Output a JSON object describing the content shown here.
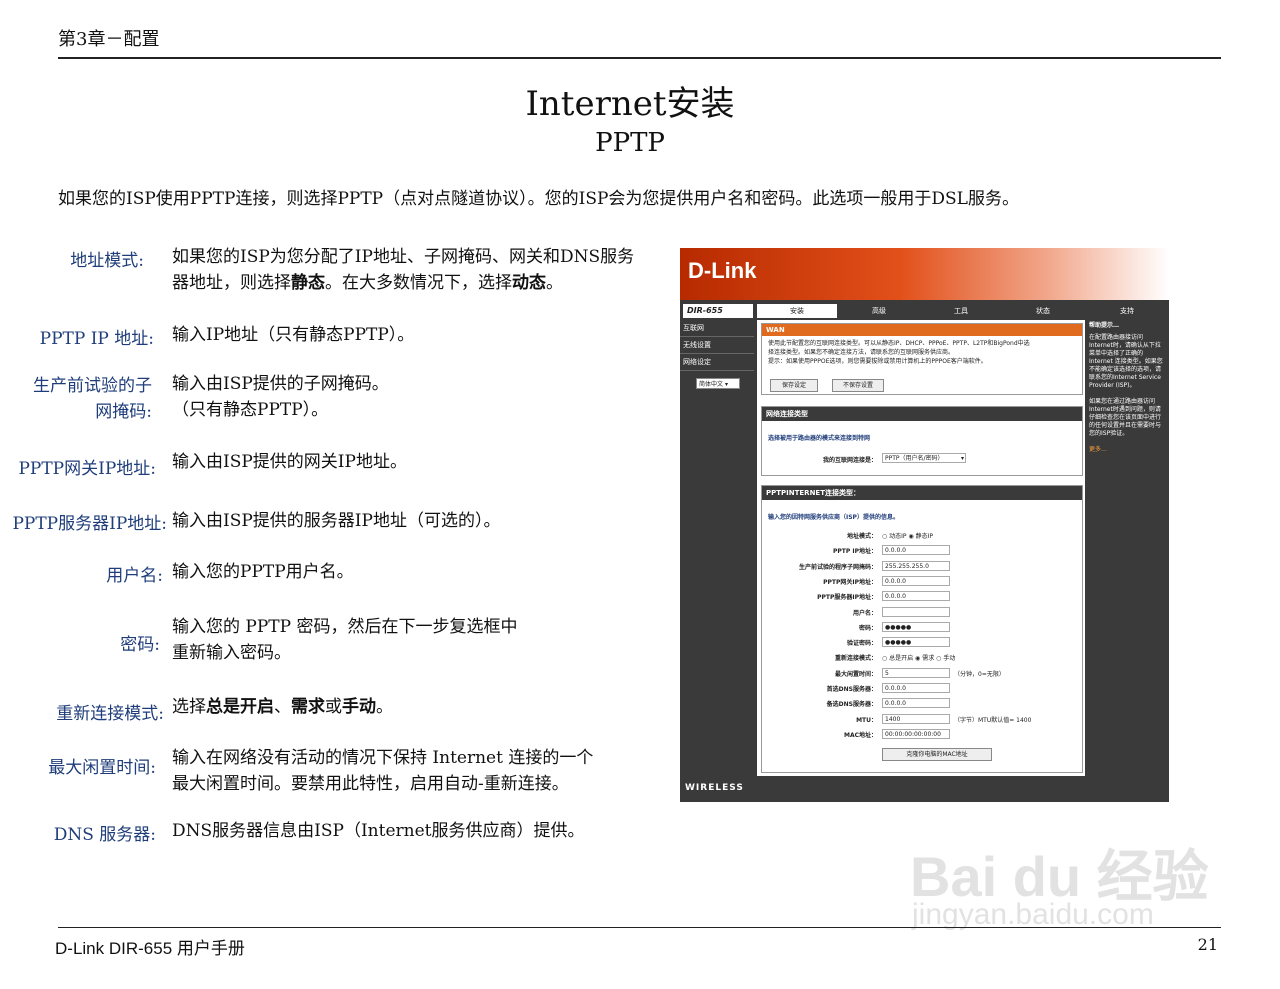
{
  "header": {
    "chapter": "第3章－配置"
  },
  "title": "Internet安装",
  "subtitle": "PPTP",
  "intro": "如果您的ISP使用PPTP连接，则选择PPTP（点对点隧道协议）。您的ISP会为您提供用户名和密码。此选项一般用于DSL服务。",
  "fields": {
    "address_mode": {
      "label": "地址模式:",
      "line1": "如果您的ISP为您分配了IP地址、子网掩码、网关和DNS服务",
      "line2a": "器地址，则选择",
      "line2b": "静态",
      "line2c": "。在大多数情况下，选择",
      "line2d": "动态",
      "line2e": "。"
    },
    "pptp_ip": {
      "label": "PPTP IP 地址:",
      "desc": "输入IP地址（只有静态PPTP）。"
    },
    "subnet": {
      "label1": "生产前试验的子",
      "label2": "网掩码:",
      "line1": "输入由ISP提供的子网掩码。",
      "line2": "（只有静态PPTP）。"
    },
    "gateway": {
      "label": "PPTP网关IP地址:",
      "desc": "输入由ISP提供的网关IP地址。"
    },
    "server": {
      "label": "PPTP服务器IP地址:",
      "desc": "输入由ISP提供的服务器IP地址（可选的）。"
    },
    "username": {
      "label": "用户名:",
      "desc": "输入您的PPTP用户名。"
    },
    "password": {
      "label": "密码:",
      "line1": "输入您的 PPTP 密码，然后在下一步复选框中",
      "line2": "重新输入密码。"
    },
    "reconnect": {
      "label": "重新连接模式:",
      "a": "选择",
      "b": "总是开启",
      "c": "、",
      "d": "需求",
      "e": "或",
      "f": "手动",
      "g": "。"
    },
    "idle": {
      "label": "最大闲置时间:",
      "line1": "输入在网络没有活动的情况下保持 Internet 连接的一个",
      "line2": "最大闲置时间。要禁用此特性，启用自动-重新连接。"
    },
    "dns": {
      "label": "DNS 服务器:",
      "desc": "DNS服务器信息由ISP（Internet服务供应商）提供。"
    }
  },
  "footer": {
    "left": "D-Link DIR-655 用户手册",
    "page": "21"
  },
  "router": {
    "logo": "D-Link",
    "model": "DIR-655",
    "tabs": [
      "安装",
      "高级",
      "工具",
      "状态",
      "支持"
    ],
    "side": [
      "互联网",
      "无线设置",
      "网络设定"
    ],
    "lang": "简体中文",
    "wan": {
      "title": "WAN",
      "text1": "使用此节配置您的互联网连接类型。可以从静态IP、DHCP、PPPoE、PPTP、L2TP和BigPond中选",
      "text2": "择连接类型。如果您不确定连接方法，请联系您的互联网服务供应商。",
      "text3": "提示：如果使用PPPOE选项，则您需要拔除或禁用计算机上的PPPOE客户端软件。",
      "save": "保存设定",
      "nosave": "不保存设置"
    },
    "conn": {
      "title": "网络连接类型",
      "desc": "选择被用于路由器的模式来连接到特网",
      "key": "我的互联网连接是：",
      "val": "PPTP（用户名/密码）"
    },
    "pptp": {
      "title": "PPTPINTERNET连接类型：",
      "desc": "输入您的因特网服务供应商（ISP）提供的信息。",
      "rows": [
        {
          "k": "地址模式：",
          "v": "",
          "t": "○ 动态IP ◉ 静态IP"
        },
        {
          "k": "PPTP IP地址：",
          "v": "0.0.0.0",
          "t": ""
        },
        {
          "k": "生产前试验的程序子网掩码：",
          "v": "255.255.255.0",
          "t": ""
        },
        {
          "k": "PPTP网关IP地址：",
          "v": "0.0.0.0",
          "t": ""
        },
        {
          "k": "PPTP服务器IP地址：",
          "v": "0.0.0.0",
          "t": ""
        },
        {
          "k": "用户名：",
          "v": "",
          "t": ""
        },
        {
          "k": "密码：",
          "v": "●●●●●",
          "t": ""
        },
        {
          "k": "验证密码：",
          "v": "●●●●●",
          "t": ""
        },
        {
          "k": "重新连接模式：",
          "v": "",
          "t": "○ 总是开启 ◉ 需求 ○ 手动"
        },
        {
          "k": "最大闲置时间：",
          "v": "5",
          "t": "（分钟，0=无限）"
        },
        {
          "k": "首选DNS服务器：",
          "v": "0.0.0.0",
          "t": ""
        },
        {
          "k": "备选DNS服务器：",
          "v": "0.0.0.0",
          "t": ""
        },
        {
          "k": "MTU：",
          "v": "1400",
          "t": "（字节）MTU默认值= 1400"
        },
        {
          "k": "MAC地址：",
          "v": "00:00:00:00:00:00",
          "t": ""
        }
      ],
      "clone": "克隆你电脑的MAC地址"
    },
    "help": {
      "title": "帮助提示…",
      "p1": "在配置路由器接访问Internet时，请确认从下拉菜单中选择了正确的Internet 连接类型。如果您不能确定该选择的选项，请联系您的Internet Service Provider (ISP)。",
      "p2": "如果您在通过路由器访问Internet时遇到问题，则请仔细检查您在该页面中进行的任何设置并且在需要时与您的ISP验证。",
      "more": "更多…"
    },
    "wireless": "WIRELESS"
  },
  "watermark": {
    "brand": "Bai du 经验",
    "url": "jingyan.baidu.com"
  }
}
